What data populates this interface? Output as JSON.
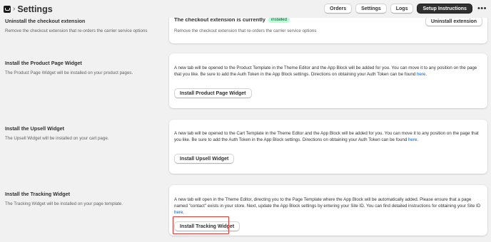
{
  "header": {
    "title": "Settings",
    "separator": "›",
    "buttons": [
      "Orders",
      "Settings",
      "Logs",
      "Setup Instructions"
    ],
    "more": "•••"
  },
  "sections": {
    "checkout": {
      "heading": "Uninstall the checkout extension",
      "description": "Remove the checkout extension that re-orders the carrier service options",
      "card_title": "The checkout extension is currently",
      "badge": "installed",
      "card_text": "Remove the checkout extension that re-orders the carrier service options",
      "button": "Uninstall extension"
    },
    "product": {
      "heading": "Install the Product Page Widget",
      "description": "The Product Page Widget will be installed on your product pages.",
      "card_text": "A new tab will be opened to the Product Template in the Theme Editor and the App Block will be added for you. You can move it to any position on the page that you like. Be sure to add the Auth Token in the App Block settings. Directions on obtaining your Auth Token can be found",
      "link": "here",
      "button": "Install Product Page Widget"
    },
    "upsell": {
      "heading": "Install the Upsell Widget",
      "description": "The Upsell Widget will be installed on your cart page.",
      "card_text": "A new tab will be opened to the Cart Template in the Theme Editor and the App Block will be added for you. You can move it to any position on the page that you like. Be sure to add the Auth Token in the App Block settings. Directions on obtaining your Auth Token can be found",
      "link": "here",
      "button": "Install Upsell Widget"
    },
    "tracking": {
      "heading": "Install the Tracking Widget",
      "description": "The Tracking Widget will be installed on your page template.",
      "card_text": "A new tab will open in the Theme Editor, directing you to the Page Template where the App Block will be automatically added. Please ensure that a page named \"contact\" exists in your store. Next, update the App Block settings by entering your Site ID. You can find detailed instructions for obtaining your Site ID",
      "link": "here",
      "button": "Install Tracking Widget"
    }
  },
  "colors": {
    "link": "#005bd3",
    "badge_bg": "#b4fed2",
    "highlight": "#e53935",
    "primary_button": "#303030"
  }
}
